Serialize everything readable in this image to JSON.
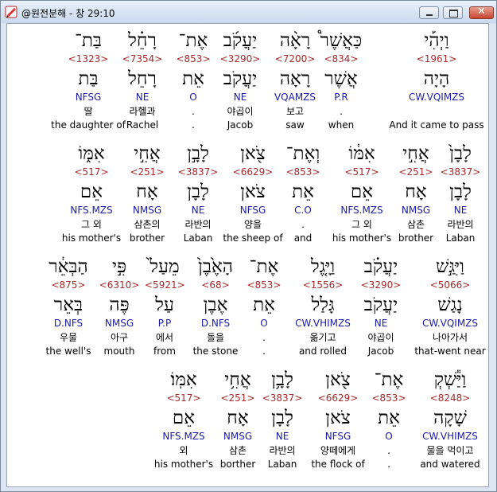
{
  "window": {
    "title": "@원전분해 - 창 29:10",
    "min_label": "minimize",
    "max_label": "maximize",
    "close_glyph": "✕"
  },
  "colors": {
    "strong": "#a52a2a",
    "morph": "#1a1aa6",
    "text": "#000000"
  },
  "rows": [
    [
      {
        "heb": "וַיְהִ֡י",
        "strong": "<1961>",
        "lemma": "הָיָה",
        "morph": "CW.VQIMZS",
        "kor": "",
        "eng": "And it came to pass"
      },
      {
        "heb": "כַּאֲשֶׁר֩",
        "strong": "<834>",
        "lemma": "אֲשֶׁר",
        "morph": "P.R",
        "kor": ".",
        "eng": "when"
      },
      {
        "heb": "רָאָ֨ה",
        "strong": "<7200>",
        "lemma": "רָאָה",
        "morph": "VQAMZS",
        "kor": "보고",
        "eng": "saw"
      },
      {
        "heb": "יַעֲקֹ֜ב",
        "strong": "<3290>",
        "lemma": "יַעֲקֹב",
        "morph": "NE",
        "kor": "야곱이",
        "eng": "Jacob"
      },
      {
        "heb": "אֶת־",
        "strong": "<853>",
        "lemma": "אֵת",
        "morph": "O",
        "kor": ".",
        "eng": "."
      },
      {
        "heb": "רָחֵ֗ל",
        "strong": "<7354>",
        "lemma": "רָחֵל",
        "morph": "NE",
        "kor": "라헬과",
        "eng": "Rachel"
      },
      {
        "heb": "בַּת־",
        "strong": "<1323>",
        "lemma": "בַּת",
        "morph": "NFSG",
        "kor": "딸",
        "eng": "the daughter of"
      }
    ],
    [
      {
        "heb": "לָבָן֙",
        "strong": "<3837>",
        "lemma": "לָבָן",
        "morph": "NE",
        "kor": "라반의",
        "eng": "Laban"
      },
      {
        "heb": "אֲחִ֣י",
        "strong": "<251>",
        "lemma": "אָח",
        "morph": "NMSG",
        "kor": "삼촌",
        "eng": "brother"
      },
      {
        "heb": "אִמּ֔וֹ",
        "strong": "<517>",
        "lemma": "אֵם",
        "morph": "NFS.MZS",
        "kor": "그 외",
        "eng": "his mother's"
      },
      {
        "heb": "וְאֶת־",
        "strong": "<853>",
        "lemma": "אֵת",
        "morph": "C.O",
        "kor": ".",
        "eng": "and"
      },
      {
        "heb": "צֹ֖אן",
        "strong": "<6629>",
        "lemma": "צֹאן",
        "morph": "NFSG",
        "kor": "양을",
        "eng": "the sheep of"
      },
      {
        "heb": "לָבָ֣ן",
        "strong": "<3837>",
        "lemma": "לָבָן",
        "morph": "NE",
        "kor": "라반의",
        "eng": "Laban"
      },
      {
        "heb": "אֲחִ֣י",
        "strong": "<251>",
        "lemma": "אָח",
        "morph": "NMSG",
        "kor": "삼촌의",
        "eng": "brother"
      },
      {
        "heb": "אִמּ֑וֹ",
        "strong": "<517>",
        "lemma": "אֵם",
        "morph": "NFS.MZS",
        "kor": "그 외",
        "eng": "his mother's"
      }
    ],
    [
      {
        "heb": "וַיִּגַּ֣שׁ",
        "strong": "<5066>",
        "lemma": "נָגַשׁ",
        "morph": "CW.VQIMZS",
        "kor": "나아가서",
        "eng": "that-went near"
      },
      {
        "heb": "יַעֲקֹ֗ב",
        "strong": "<3290>",
        "lemma": "יַעֲקֹב",
        "morph": "NE",
        "kor": "야곱이",
        "eng": "Jacob"
      },
      {
        "heb": "וַיָּ֤גֶל",
        "strong": "<1556>",
        "lemma": "גָּלַל",
        "morph": "CW.VHIMZS",
        "kor": "옮기고",
        "eng": "and rolled"
      },
      {
        "heb": "אֶת־",
        "strong": "<853>",
        "lemma": "אֵת",
        "morph": "O",
        "kor": ".",
        "eng": "."
      },
      {
        "heb": "הָאֶ֙בֶן֙",
        "strong": "<68>",
        "lemma": "אֶבֶן",
        "morph": "D.NFS",
        "kor": "돌을",
        "eng": "the stone"
      },
      {
        "heb": "מֵעַל֙",
        "strong": "<5921>",
        "lemma": "עַל",
        "morph": "P.P",
        "kor": "에서",
        "eng": "from"
      },
      {
        "heb": "פִּ֣י",
        "strong": "<6310>",
        "lemma": "פֶּה",
        "morph": "NMSG",
        "kor": "아구",
        "eng": "mouth"
      },
      {
        "heb": "הַבְּאֵ֔ר",
        "strong": "<875>",
        "lemma": "בְּאֵר",
        "morph": "D.NFS",
        "kor": "우물",
        "eng": "the well's"
      }
    ],
    [
      {
        "heb": "וַיַּ֕שְׁקְ",
        "strong": "<8248>",
        "lemma": "שָׁקָה",
        "morph": "CW.VHIMZS",
        "kor": "물을 먹이고",
        "eng": "and watered"
      },
      {
        "heb": "אֶת־",
        "strong": "<853>",
        "lemma": "אֵת",
        "morph": "O",
        "kor": ".",
        "eng": "."
      },
      {
        "heb": "צֹ֖אן",
        "strong": "<6629>",
        "lemma": "צֹאן",
        "morph": "NFSG",
        "kor": "양떼에게",
        "eng": "the flock of"
      },
      {
        "heb": "לָבָ֥ן",
        "strong": "<3837>",
        "lemma": "לָבָן",
        "morph": "NE",
        "kor": "라반의",
        "eng": "Laban"
      },
      {
        "heb": "אֲחִ֥י",
        "strong": "<251>",
        "lemma": "אָח",
        "morph": "NMSG",
        "kor": "삼촌",
        "eng": "borther"
      },
      {
        "heb": "אִמּֽוֹ׃",
        "strong": "<517>",
        "lemma": "אֵם",
        "morph": "NFS.MZS",
        "kor": "외",
        "eng": "his mother's"
      }
    ]
  ]
}
